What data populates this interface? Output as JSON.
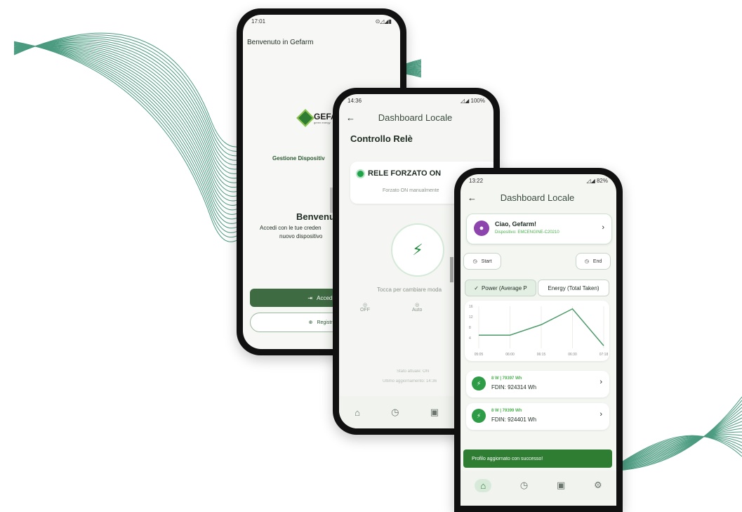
{
  "colors": {
    "brand_green": "#2e7d32",
    "accent": "#1ea24a",
    "purple": "#8e44ad",
    "wave": "#2b8a6a"
  },
  "phone1": {
    "status_time": "17:01",
    "status_icons": "⊙◿◢▮",
    "welcome_header": "Benvenuto in Gefarm",
    "logo_text": "GEFAR",
    "logo_tagline": "green energy",
    "subtitle": "Gestione Dispositiv",
    "heading": "Benvenut",
    "desc_line1": "Accedi con le tue creden",
    "desc_line2": "nuovo dispositivo",
    "login_button": "Accedi al tuo a",
    "register_button": "Registra nuovo d"
  },
  "phone2": {
    "status_time": "14:36",
    "status_right": "◿◢ 100%",
    "app_title": "Dashboard Locale",
    "section_title": "Controllo Relè",
    "relay_state": "RELE FORZATO ON",
    "relay_sub": "Forzato ON manualmente",
    "tap_hint": "Tocca per cambiare moda",
    "mode_off": "OFF",
    "mode_auto": "Auto",
    "state_current": "Stato attuale: ON",
    "last_update": "Ultimo aggiornamento: 14:36"
  },
  "phone3": {
    "status_time": "13:22",
    "status_right": "◿◢ 82%",
    "app_title": "Dashboard Locale",
    "greeting": "Ciao, Gefarm!",
    "device": "Dispositivo: EMCENGINE-C20210",
    "start_label": "Start",
    "end_label": "End",
    "tab_power": "Power (Average P",
    "tab_energy": "Energy (Total Taken)",
    "toast": "Profilo aggiornato con successo!",
    "readings": [
      {
        "power": "8 W | 79397 Wh",
        "fdin": "FDIN: 924314 Wh"
      },
      {
        "power": "8 W | 79399 Wh",
        "fdin": "FDIN: 924401 Wh"
      }
    ]
  },
  "chart_data": {
    "type": "line",
    "x": [
      "05:05",
      "06:00",
      "06:15",
      "06:30",
      "07:18"
    ],
    "y_ticks": [
      "16",
      "12",
      "8",
      "4"
    ],
    "series": [
      {
        "values": [
          5,
          5,
          9,
          15,
          1
        ]
      }
    ],
    "ylim": [
      0,
      16
    ],
    "xlabel": "",
    "ylabel": "",
    "title": ""
  }
}
